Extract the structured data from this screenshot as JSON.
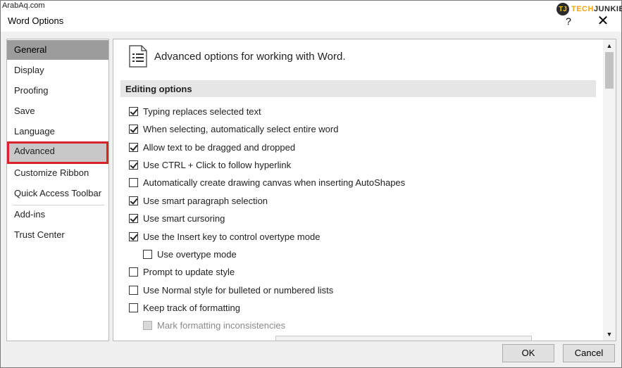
{
  "watermark": {
    "left_text": "ArabAq.com",
    "logo_initials": "TJ",
    "brand_part1": "TECH",
    "brand_part2": "JUNKIE"
  },
  "window": {
    "title": "Word Options",
    "help_label": "?",
    "close_label": "✕"
  },
  "sidebar": {
    "items": [
      {
        "label": "General"
      },
      {
        "label": "Display"
      },
      {
        "label": "Proofing"
      },
      {
        "label": "Save"
      },
      {
        "label": "Language"
      },
      {
        "label": "Advanced"
      },
      {
        "label": "Customize Ribbon"
      },
      {
        "label": "Quick Access Toolbar"
      },
      {
        "label": "Add-ins"
      },
      {
        "label": "Trust Center"
      }
    ],
    "selected": "General",
    "highlighted": "Advanced"
  },
  "main": {
    "header": "Advanced options for working with Word.",
    "section_title": "Editing options",
    "options": [
      {
        "label": "Typing replaces selected text",
        "checked": true
      },
      {
        "label": "When selecting, automatically select entire word",
        "checked": true
      },
      {
        "label": "Allow text to be dragged and dropped",
        "checked": true
      },
      {
        "label": "Use CTRL + Click to follow hyperlink",
        "checked": true
      },
      {
        "label": "Automatically create drawing canvas when inserting AutoShapes",
        "checked": false
      },
      {
        "label": "Use smart paragraph selection",
        "checked": true
      },
      {
        "label": "Use smart cursoring",
        "checked": true
      },
      {
        "label": "Use the Insert key to control overtype mode",
        "checked": true
      },
      {
        "label": "Use overtype mode",
        "checked": false
      },
      {
        "label": "Prompt to update style",
        "checked": false
      },
      {
        "label": "Use Normal style for bulleted or numbered lists",
        "checked": false
      },
      {
        "label": "Keep track of formatting",
        "checked": false
      },
      {
        "label": "Mark formatting inconsistencies",
        "checked": false,
        "disabled": true
      }
    ]
  },
  "footer": {
    "ok_label": "OK",
    "cancel_label": "Cancel"
  },
  "colors": {
    "highlight_border": "#d9222a",
    "selected_bg": "#9c9c9c",
    "background_green": "#4d8a3f"
  }
}
